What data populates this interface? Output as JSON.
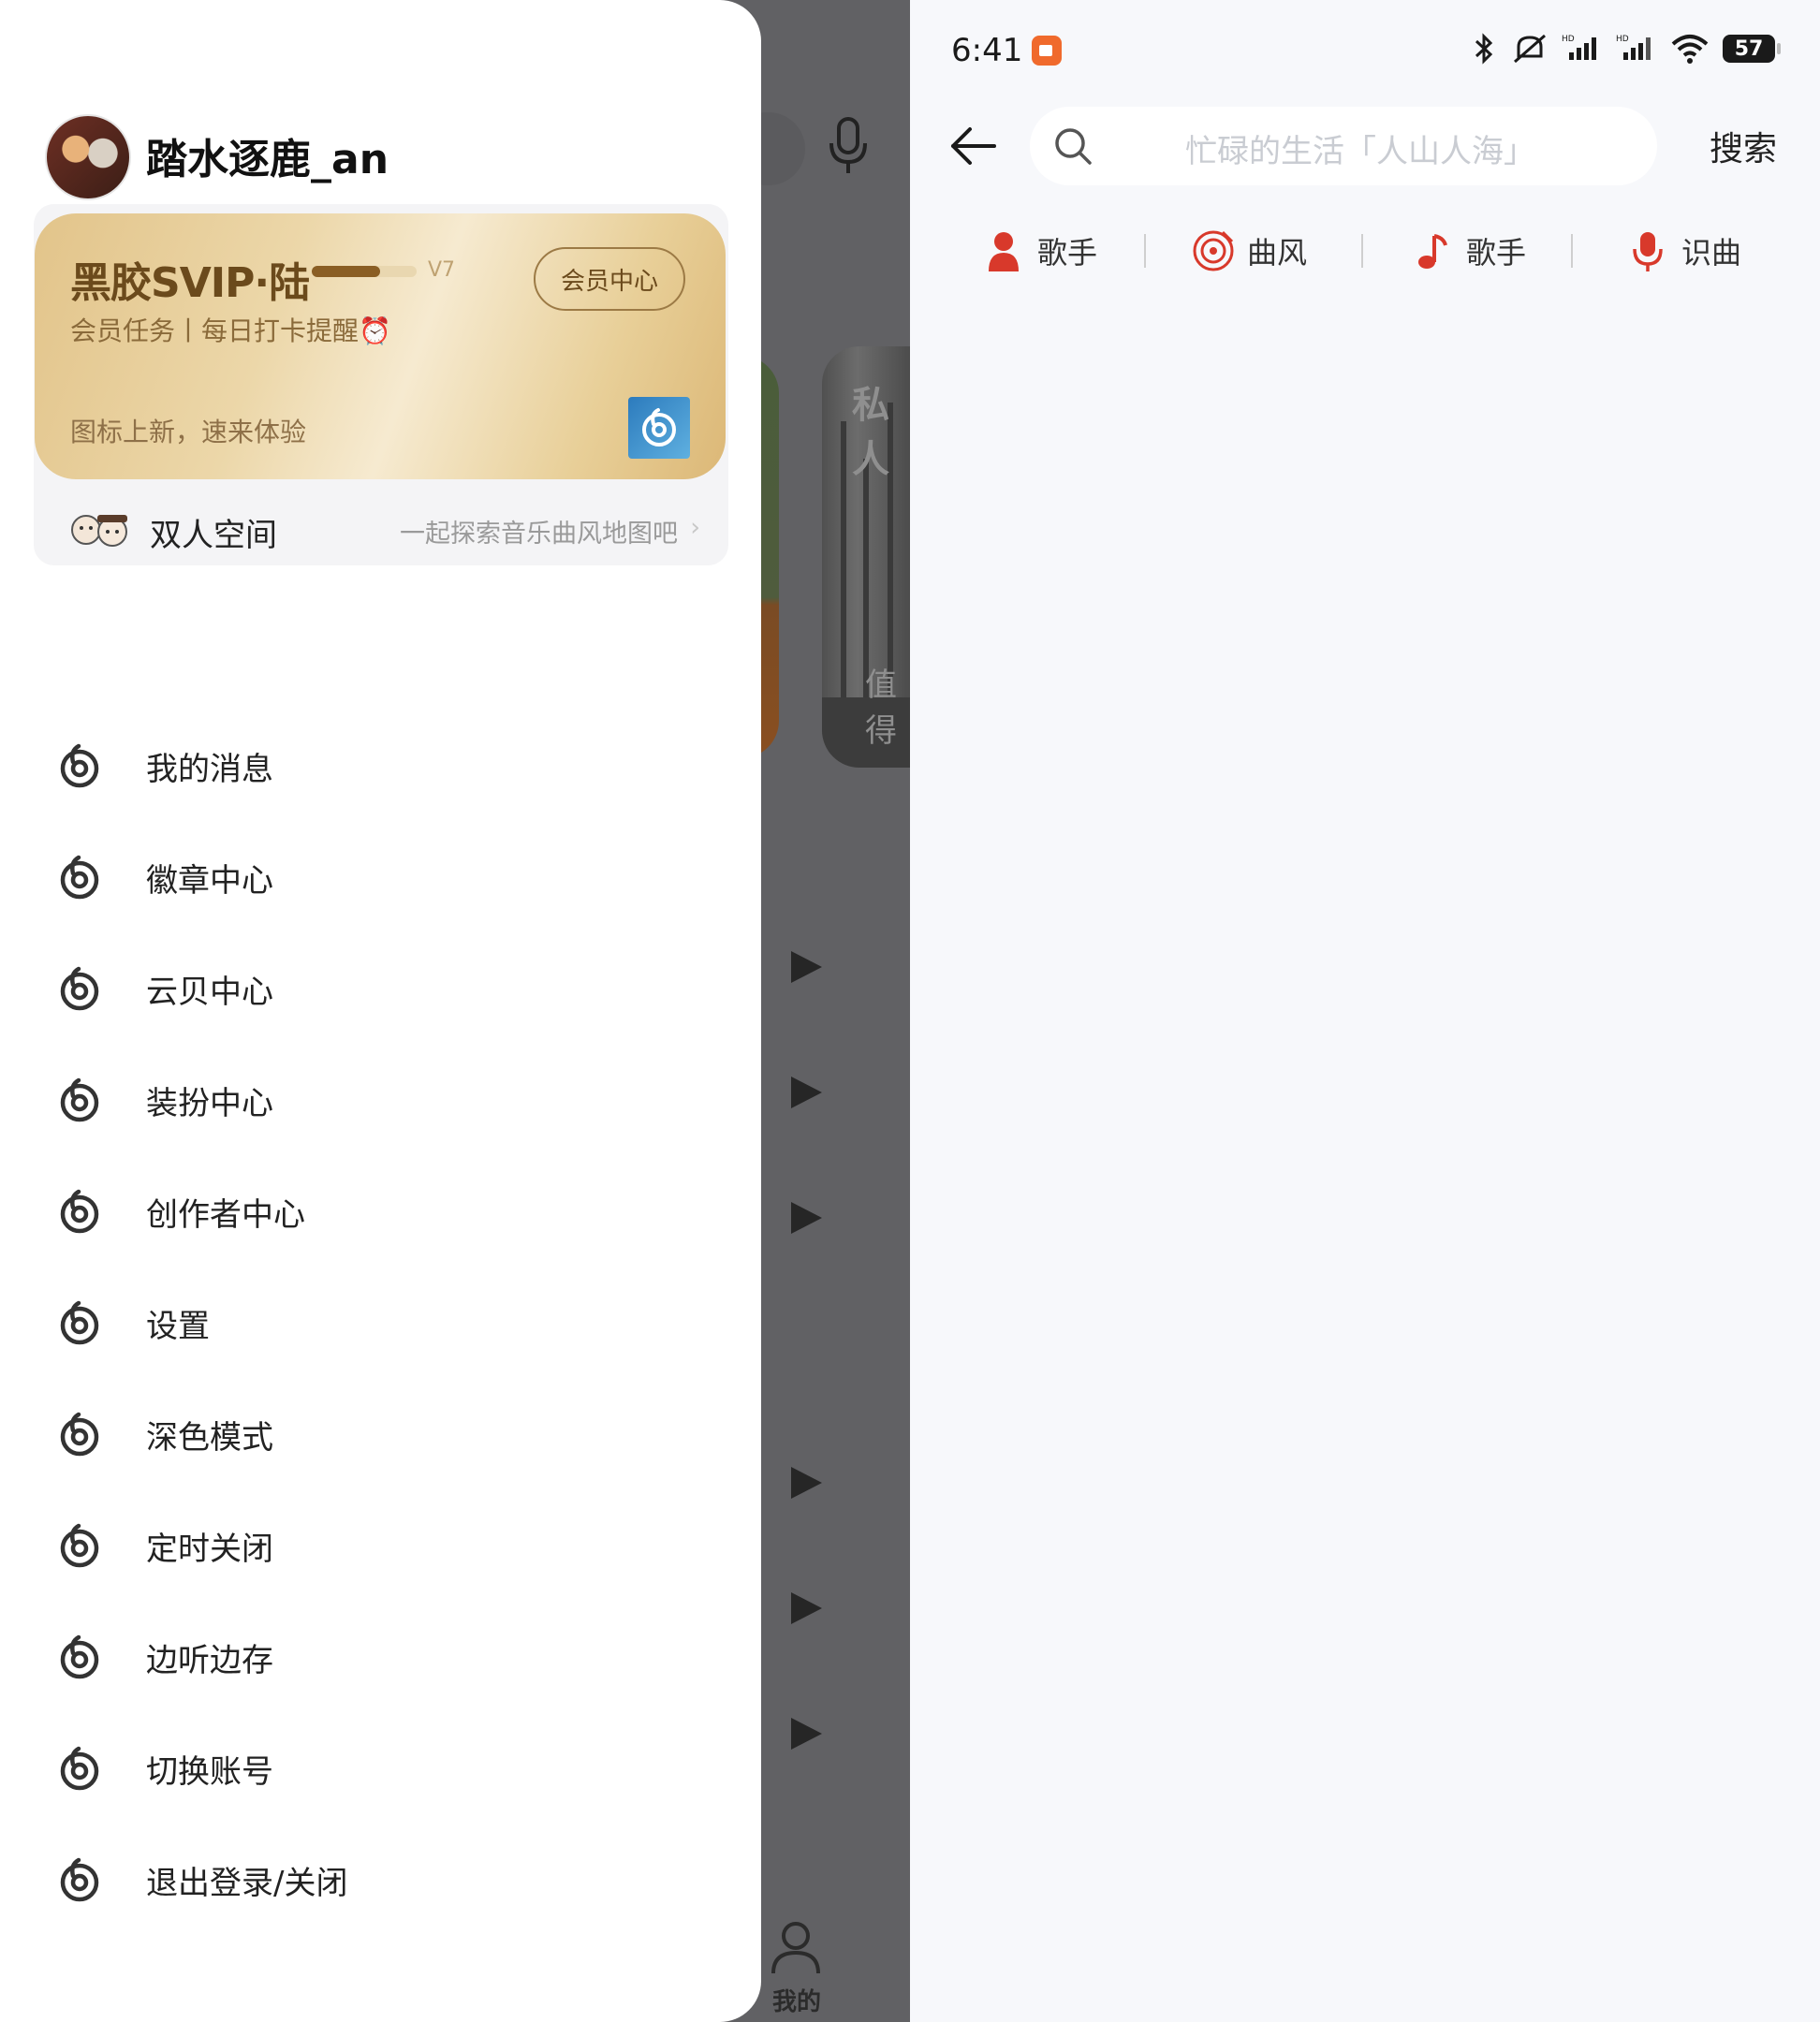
{
  "background": {
    "card_top_text": "私人",
    "card_bottom_text": "值得",
    "tab_label": "我的"
  },
  "drawer": {
    "username": "踏水逐鹿_an",
    "vip": {
      "title": "黑胶SVIP·陆",
      "level": "V7",
      "level_progress": 0.65,
      "subtitle": "会员任务丨每日打卡提醒⏰",
      "center_button": "会员中心",
      "icon_note": "图标上新，速来体验"
    },
    "duo": {
      "title": "双人空间",
      "desc": "一起探索音乐曲风地图吧",
      "chevron": "›"
    },
    "menu": [
      {
        "label": "我的消息",
        "icon": "netease-logo-icon"
      },
      {
        "label": "徽章中心",
        "icon": "netease-logo-icon"
      },
      {
        "label": "云贝中心",
        "icon": "netease-logo-icon"
      },
      {
        "label": "装扮中心",
        "icon": "netease-logo-icon"
      },
      {
        "label": "创作者中心",
        "icon": "netease-logo-icon"
      },
      {
        "label": "设置",
        "icon": "netease-logo-icon"
      },
      {
        "label": "深色模式",
        "icon": "netease-logo-icon"
      },
      {
        "label": "定时关闭",
        "icon": "netease-logo-icon"
      },
      {
        "label": "边听边存",
        "icon": "netease-logo-icon"
      },
      {
        "label": "切换账号",
        "icon": "netease-logo-icon"
      },
      {
        "label": "退出登录/关闭",
        "icon": "netease-logo-icon"
      }
    ]
  },
  "statusbar": {
    "time": "6:41",
    "battery": "57",
    "icons": [
      "bluetooth-icon",
      "mute-icon",
      "hd-signal-icon",
      "hd-signal-icon",
      "wifi-icon",
      "battery-icon"
    ]
  },
  "search": {
    "placeholder": "忙碌的生活「人山人海」",
    "button": "搜索"
  },
  "chips": [
    {
      "label": "歌手",
      "icon": "singer-icon"
    },
    {
      "label": "曲风",
      "icon": "vinyl-icon"
    },
    {
      "label": "歌手",
      "icon": "music-note-icon"
    },
    {
      "label": "识曲",
      "icon": "mic-icon"
    }
  ],
  "colors": {
    "accent_red": "#d8392b",
    "vip_gold": "#e6cb93",
    "drawer_bg": "#ffffff",
    "overlay_gray": "#616164"
  }
}
